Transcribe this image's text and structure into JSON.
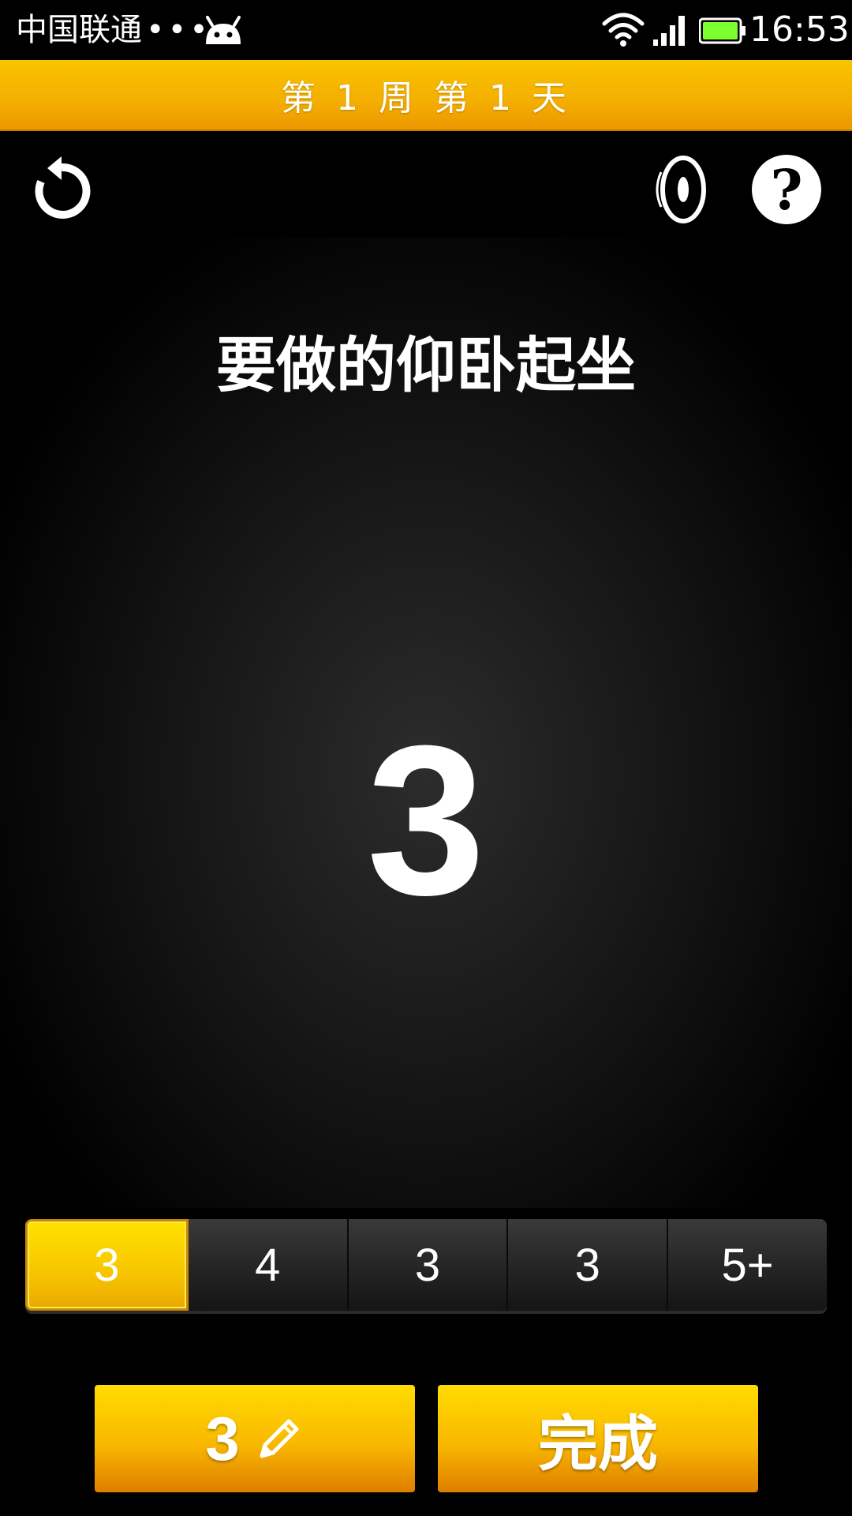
{
  "status_bar": {
    "carrier": "中国联通",
    "dots": "•••",
    "time": "16:53"
  },
  "header": {
    "title": "第 1 周 第 1 天"
  },
  "toolbar": {
    "reset_icon": "reset-icon",
    "sound_icon": "sound-icon",
    "help_label": "?"
  },
  "main": {
    "heading": "要做的仰卧起坐",
    "count": "3"
  },
  "sets": [
    {
      "label": "3",
      "active": true
    },
    {
      "label": "4",
      "active": false
    },
    {
      "label": "3",
      "active": false
    },
    {
      "label": "3",
      "active": false
    },
    {
      "label": "5+",
      "active": false
    }
  ],
  "buttons": {
    "edit_count": "3",
    "done_label": "完成"
  },
  "colors": {
    "accent": "#f9c400",
    "accent_dark": "#ec9800",
    "background": "#000000",
    "battery": "#7cff2e"
  }
}
